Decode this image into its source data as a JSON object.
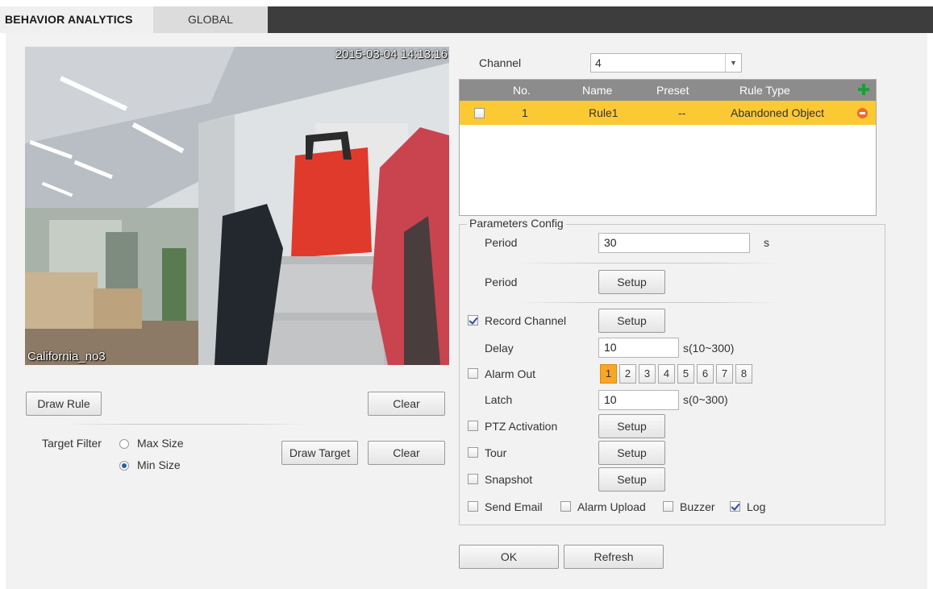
{
  "tabs": [
    {
      "label": "BEHAVIOR ANALYTICS",
      "active": true
    },
    {
      "label": "GLOBAL",
      "active": false
    }
  ],
  "video": {
    "timestamp": "2015-03-04 14:13:16",
    "channel_name": "California_no3"
  },
  "left_controls": {
    "draw_rule": "Draw Rule",
    "clear1": "Clear",
    "target_filter_label": "Target Filter",
    "max_size": "Max Size",
    "min_size": "Min Size",
    "selected_size": "Min Size",
    "draw_target": "Draw Target",
    "clear2": "Clear"
  },
  "channel": {
    "label": "Channel",
    "value": "4"
  },
  "rules_table": {
    "columns": [
      "No.",
      "Name",
      "Preset",
      "Rule Type"
    ],
    "rows": [
      {
        "no": "1",
        "name": "Rule1",
        "preset": "--",
        "rule_type": "Abandoned Object",
        "selected": true,
        "checked": false
      }
    ]
  },
  "params": {
    "title": "Parameters Config",
    "period_label": "Period",
    "period_value": "30",
    "period_unit": "s",
    "period2_label": "Period",
    "setup": "Setup",
    "record_channel": {
      "label": "Record Channel",
      "checked": true
    },
    "delay_label": "Delay",
    "delay_value": "10",
    "delay_unit": "s(10~300)",
    "alarm_out": {
      "label": "Alarm Out",
      "checked": false,
      "outputs": [
        "1",
        "2",
        "3",
        "4",
        "5",
        "6",
        "7",
        "8"
      ],
      "selected": "1"
    },
    "latch_label": "Latch",
    "latch_value": "10",
    "latch_unit": "s(0~300)",
    "ptz_activation": {
      "label": "PTZ Activation",
      "checked": false
    },
    "tour": {
      "label": "Tour",
      "checked": false
    },
    "snapshot": {
      "label": "Snapshot",
      "checked": false
    },
    "send_email": {
      "label": "Send Email",
      "checked": false
    },
    "alarm_upload": {
      "label": "Alarm Upload",
      "checked": false
    },
    "buzzer": {
      "label": "Buzzer",
      "checked": false
    },
    "log": {
      "label": "Log",
      "checked": true
    }
  },
  "footer": {
    "ok": "OK",
    "refresh": "Refresh"
  },
  "colors": {
    "selected_row": "#fbc934",
    "table_header": "#8c8c8c",
    "active_output": "#f9a626",
    "tab_bar": "#3d3d3d"
  }
}
